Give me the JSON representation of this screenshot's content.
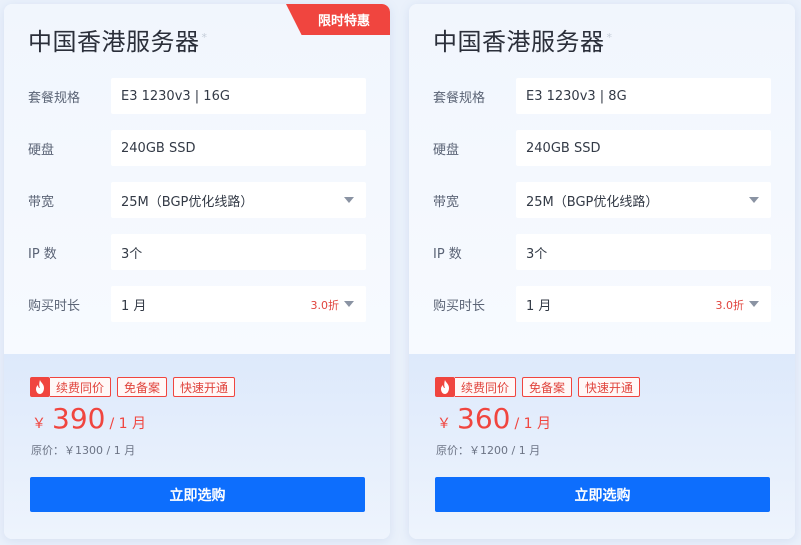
{
  "colors": {
    "accent": "#0d6efd",
    "promo": "#f0453f"
  },
  "cards": [
    {
      "ribbon": "限时特惠",
      "title": "中国香港服务器",
      "title_mark": "*",
      "specs": [
        {
          "label": "套餐规格",
          "value": "E3 1230v3 | 16G"
        },
        {
          "label": "硬盘",
          "value": "240GB SSD"
        },
        {
          "label": "带宽",
          "value": "25M（BGP优化线路）"
        },
        {
          "label": "IP 数",
          "value": "3个"
        },
        {
          "label": "购买时长",
          "value": "1 月",
          "discount": "3.0折"
        }
      ],
      "tags": [
        "续费同价",
        "免备案",
        "快速开通"
      ],
      "price": {
        "currency": "￥",
        "amount": "390",
        "unit": "/ 1 月"
      },
      "original": "原价：￥1300 / 1 月",
      "buy_label": "立即选购"
    },
    {
      "title": "中国香港服务器",
      "title_mark": "*",
      "specs": [
        {
          "label": "套餐规格",
          "value": "E3 1230v3 | 8G"
        },
        {
          "label": "硬盘",
          "value": "240GB SSD"
        },
        {
          "label": "带宽",
          "value": "25M（BGP优化线路）"
        },
        {
          "label": "IP 数",
          "value": "3个"
        },
        {
          "label": "购买时长",
          "value": "1 月",
          "discount": "3.0折"
        }
      ],
      "tags": [
        "续费同价",
        "免备案",
        "快速开通"
      ],
      "price": {
        "currency": "￥",
        "amount": "360",
        "unit": "/ 1 月"
      },
      "original": "原价：￥1200 / 1 月",
      "buy_label": "立即选购"
    }
  ]
}
